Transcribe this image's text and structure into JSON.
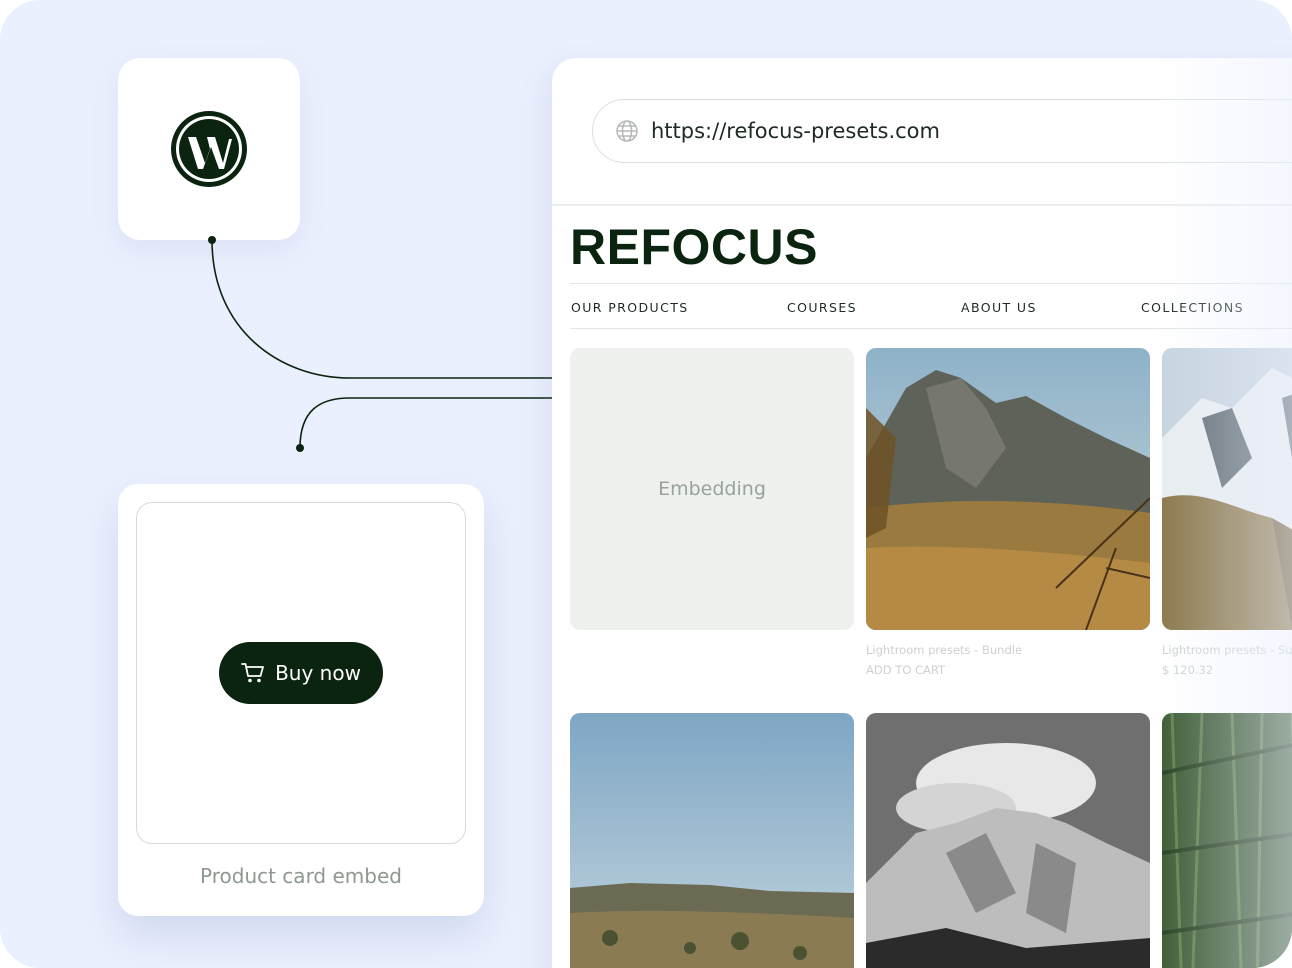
{
  "wordpress": {
    "logo_icon": "wordpress-logo-icon"
  },
  "embed_card": {
    "button_label": "Buy now",
    "button_icon": "cart-icon",
    "caption": "Product card embed"
  },
  "browser": {
    "url_icon": "globe-icon",
    "url": "https://refocus-presets.com",
    "brand": "REFOCUS",
    "nav": [
      "OUR PRODUCTS",
      "COURSES",
      "ABOUT US",
      "COLLECTIONS"
    ],
    "embedding_label": "Embedding",
    "products": [
      {
        "name": "Lightroom presets - Bundle",
        "sub": "ADD TO CART"
      },
      {
        "name": "Lightroom presets - Su",
        "sub": "$ 120.32"
      }
    ]
  },
  "colors": {
    "accent": "#0b2410",
    "background": "#ebf0fe"
  }
}
